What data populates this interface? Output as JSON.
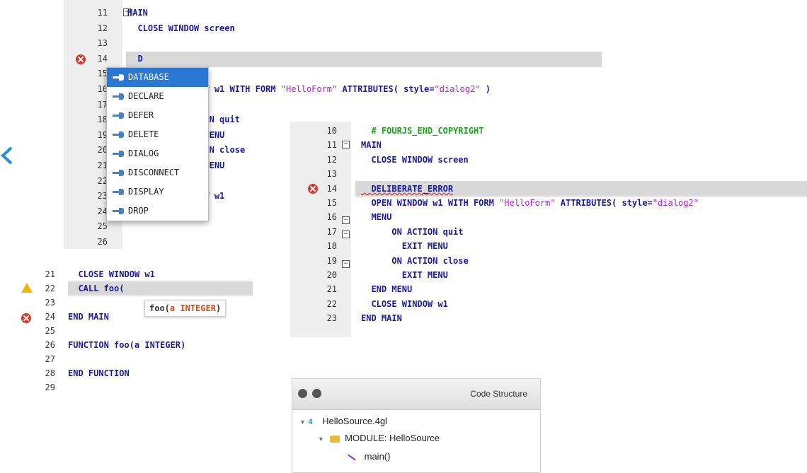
{
  "nav": {
    "chevron": "<"
  },
  "editor1": {
    "lines": [
      {
        "num": "11",
        "code": "MAIN"
      },
      {
        "num": "12",
        "code": "  CLOSE WINDOW screen"
      },
      {
        "num": "13",
        "code": ""
      },
      {
        "num": "14",
        "code": "  D"
      },
      {
        "num": "15",
        "code": ""
      },
      {
        "num": "16",
        "code": "               W w1 WITH FORM \"HelloForm\" ATTRIBUTES( style=\"dialog2\" )"
      },
      {
        "num": "17",
        "code": ""
      },
      {
        "num": "18",
        "code": "               ON quit"
      },
      {
        "num": "19",
        "code": "               MENU"
      },
      {
        "num": "20",
        "code": "               ON close"
      },
      {
        "num": "21",
        "code": "               MENU"
      },
      {
        "num": "22",
        "code": ""
      },
      {
        "num": "23",
        "code": "               W w1"
      },
      {
        "num": "24",
        "code": ""
      },
      {
        "num": "25",
        "code": ""
      },
      {
        "num": "26",
        "code": ""
      }
    ],
    "completion": [
      "DATABASE",
      "DECLARE",
      "DEFER",
      "DELETE",
      "DIALOG",
      "DISCONNECT",
      "DISPLAY",
      "DROP"
    ],
    "selected_index": 0,
    "error_icon": "error-icon"
  },
  "editor2": {
    "lines": [
      {
        "num": "10",
        "code": "  # FOURJS_END_COPYRIGHT"
      },
      {
        "num": "11",
        "code": "MAIN"
      },
      {
        "num": "12",
        "code": "  CLOSE WINDOW screen"
      },
      {
        "num": "13",
        "code": ""
      },
      {
        "num": "14",
        "code": "  DELIBERATE_ERROR"
      },
      {
        "num": "15",
        "code": "  OPEN WINDOW w1 WITH FORM \"HelloForm\" ATTRIBUTES( style=\"dialog2\""
      },
      {
        "num": "16",
        "code": "  MENU"
      },
      {
        "num": "17",
        "code": "      ON ACTION quit"
      },
      {
        "num": "18",
        "code": "        EXIT MENU"
      },
      {
        "num": "19",
        "code": "      ON ACTION close"
      },
      {
        "num": "20",
        "code": "        EXIT MENU"
      },
      {
        "num": "21",
        "code": "  END MENU"
      },
      {
        "num": "22",
        "code": "  CLOSE WINDOW w1"
      },
      {
        "num": "23",
        "code": "END MAIN"
      }
    ]
  },
  "editor3": {
    "lines": [
      {
        "num": "21",
        "code": "  CLOSE WINDOW w1"
      },
      {
        "num": "22",
        "code": "  CALL foo("
      },
      {
        "num": "23",
        "code": ""
      },
      {
        "num": "24",
        "code": "END MAIN"
      },
      {
        "num": "25",
        "code": ""
      },
      {
        "num": "26",
        "code": "FUNCTION foo(a INTEGER)"
      },
      {
        "num": "27",
        "code": ""
      },
      {
        "num": "28",
        "code": "END FUNCTION"
      },
      {
        "num": "29",
        "code": ""
      }
    ],
    "tooltip": "foo(a INTEGER)",
    "tooltip_fn": "foo(",
    "tooltip_param": "a INTEGER",
    "tooltip_close": ")"
  },
  "code_structure": {
    "title": "Code Structure",
    "file": "HelloSource.4gl",
    "module": "MODULE: HelloSource",
    "function": "main()"
  },
  "colors": {
    "keyword": "#1a1aa0",
    "string": "#b01de0",
    "comment": "#22a022",
    "error": "#d9362c",
    "selection": "#2a78d4"
  }
}
